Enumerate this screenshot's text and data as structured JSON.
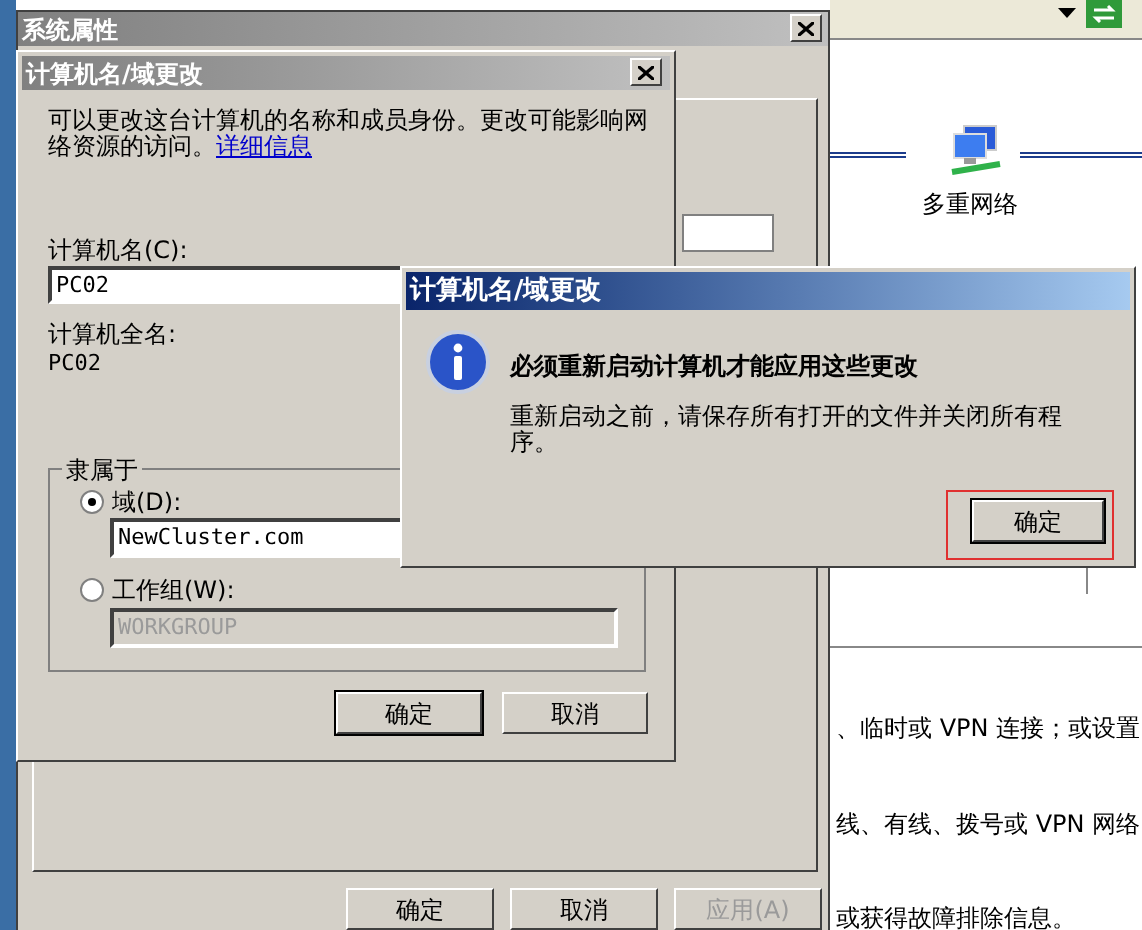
{
  "background_page": {
    "network_label": "多重网络",
    "lines": [
      "、临时或 VPN 连接；或设置",
      "线、有线、拨号或 VPN 网络",
      "或获得故障排除信息。"
    ]
  },
  "system_properties": {
    "title": "系统属性",
    "buttons": [
      {
        "label": "确定",
        "disabled": false
      },
      {
        "label": "取消",
        "disabled": false
      },
      {
        "label": "应用(A)",
        "disabled": true
      }
    ]
  },
  "name_dialog": {
    "title": "计算机名/域更改",
    "intro": "可以更改这台计算机的名称和成员身份。更改可能影响网络资源的访问。",
    "link": "详细信息",
    "computer_name_label": "计算机名(C):",
    "computer_name": "PC02",
    "full_name_label": "计算机全名:",
    "full_name": "PC02",
    "member_of": "隶属于",
    "options": [
      {
        "label": "域(D):",
        "selected": true,
        "value": "NewCluster.com",
        "disabled": false
      },
      {
        "label": "工作组(W):",
        "selected": false,
        "value": "WORKGROUP",
        "disabled": true
      }
    ],
    "buttons": [
      {
        "label": "确定",
        "default": true
      },
      {
        "label": "取消",
        "default": false
      }
    ]
  },
  "message_box": {
    "title": "计算机名/域更改",
    "heading": "必须重新启动计算机才能应用这些更改",
    "body": "重新启动之前，请保存所有打开的文件并关闭所有程序。",
    "button": "确定"
  }
}
